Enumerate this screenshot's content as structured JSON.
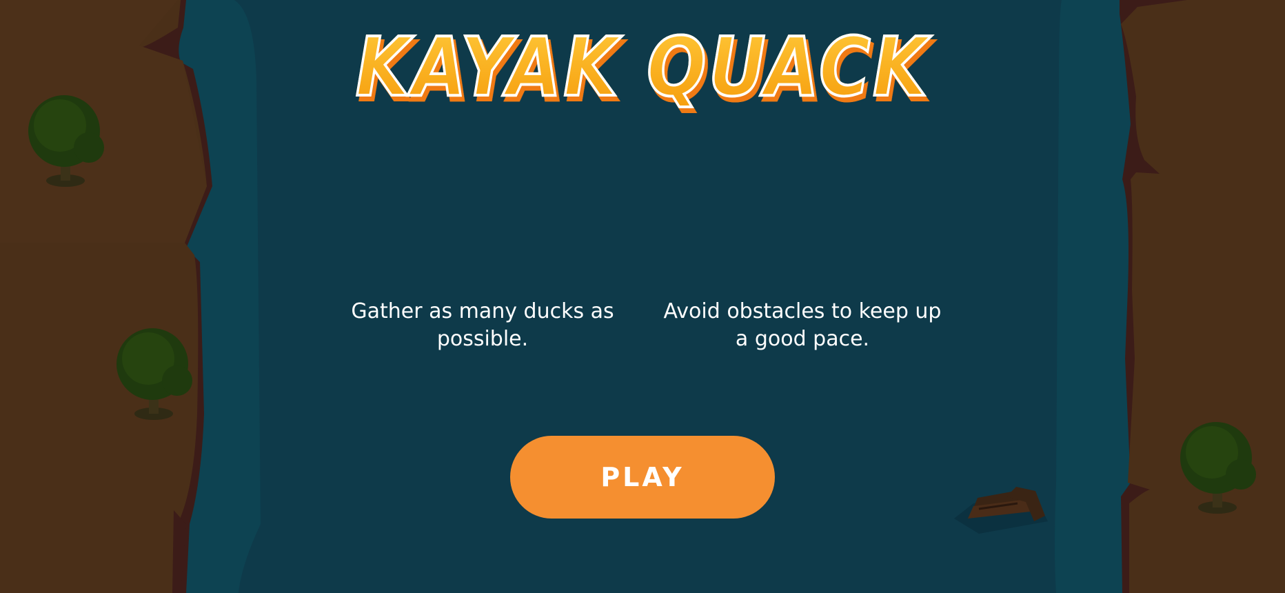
{
  "game": {
    "title": "KAYAK QUACK"
  },
  "instructions": {
    "collect_ducks": "Gather as many ducks as possible.",
    "avoid_obstacles": "Avoid obstacles to keep up a good pace."
  },
  "menu": {
    "play_label": "PLAY"
  },
  "colors": {
    "river": "#0e3a4a",
    "river_edge": "#0d4352",
    "bank": "#4a2f18",
    "cliff_shadow": "#3c1c18",
    "tree_foliage": "#243a10",
    "title_fill": "#ffb21e",
    "title_shadow": "#f07a14",
    "play_button": "#f58f30"
  },
  "scenery": {
    "trees": [
      "tree",
      "tree",
      "tree"
    ],
    "obstacles": [
      "floating-log"
    ]
  }
}
